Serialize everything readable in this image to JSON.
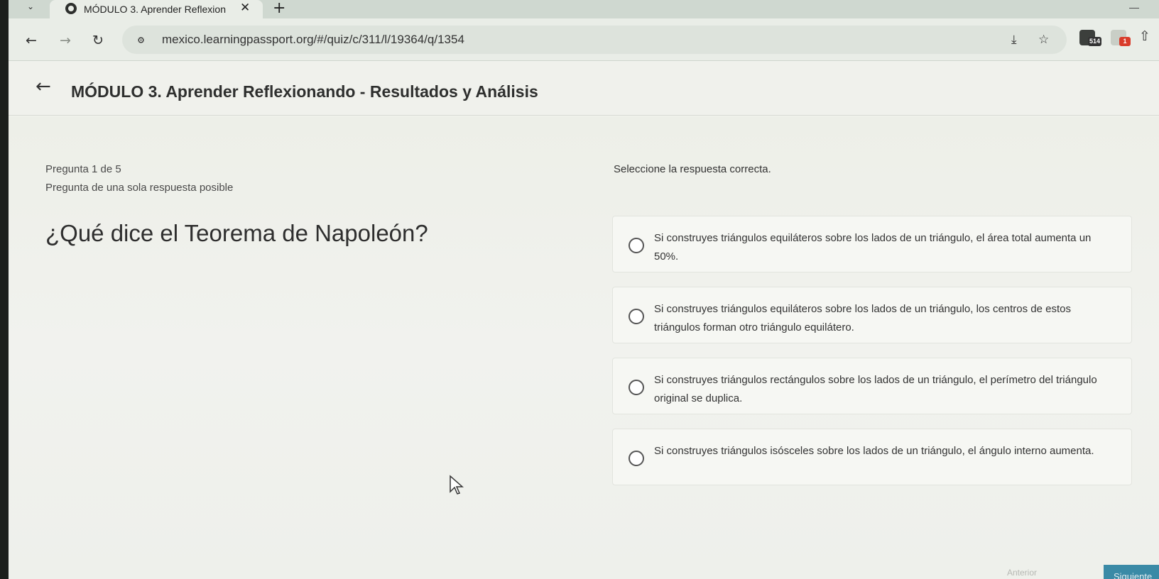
{
  "browser": {
    "tab_title": "MÓDULO 3. Aprender Reflexion",
    "tab_close": "✕",
    "new_tab": "+",
    "url": "mexico.learningpassport.org/#/quiz/c/311/l/19364/q/1354",
    "extensions": [
      {
        "name": "cast-icon"
      },
      {
        "name": "bookmark-star-icon"
      },
      {
        "name": "extension-icon",
        "badge": "514"
      },
      {
        "name": "extension-icon",
        "badge": "1"
      },
      {
        "name": "share-icon"
      }
    ]
  },
  "header": {
    "title": "MÓDULO 3. Aprender Reflexionando - Resultados y Análisis"
  },
  "quiz": {
    "counter": "Pregunta 1 de 5",
    "type": "Pregunta de una sola respuesta posible",
    "instruction": "Seleccione la respuesta correcta.",
    "question": "¿Qué dice el Teorema de Napoleón?",
    "options": [
      {
        "text": "Si construyes triángulos equiláteros sobre los lados de un triángulo, el área total aumenta un 50%."
      },
      {
        "text": "Si construyes triángulos equiláteros sobre los lados de un triángulo, los centros de estos triángulos forman otro triángulo equilátero."
      },
      {
        "text": "Si construyes triángulos rectángulos sobre los lados de un triángulo, el perímetro del triángulo original se duplica."
      },
      {
        "text": "Si construyes triángulos isósceles sobre los lados de un triángulo, el ángulo interno aumenta."
      }
    ],
    "prev_label": "Anterior",
    "next_label": "Siguiente"
  },
  "colors": {
    "accent": "#3a8aa6",
    "background": "#f2f3ee"
  }
}
